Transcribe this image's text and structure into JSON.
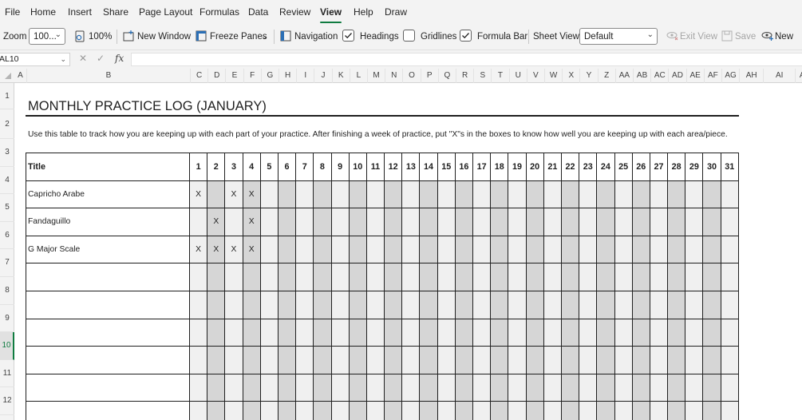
{
  "menu": {
    "tabs": [
      "File",
      "Home",
      "Insert",
      "Share",
      "Page Layout",
      "Formulas",
      "Data",
      "Review",
      "View",
      "Help",
      "Draw"
    ],
    "active": "View"
  },
  "ribbon": {
    "zoom_label": "Zoom",
    "zoom_value": "100...",
    "zoom_100_label": "100%",
    "new_window_label": "New Window",
    "freeze_panes_label": "Freeze Panes",
    "navigation_label": "Navigation",
    "headings_label": "Headings",
    "headings_checked": true,
    "gridlines_label": "Gridlines",
    "gridlines_checked": false,
    "formula_bar_label": "Formula Bar",
    "formula_bar_checked": true,
    "sheet_view_label": "Sheet View",
    "sheet_view_value": "Default",
    "exit_view_label": "Exit View",
    "save_label": "Save",
    "new_label": "New"
  },
  "formula_bar": {
    "name_box": "AL10",
    "fx_label": "fx",
    "formula": ""
  },
  "grid": {
    "columns": [
      "A",
      "B",
      "C",
      "D",
      "E",
      "F",
      "G",
      "H",
      "I",
      "J",
      "K",
      "L",
      "M",
      "N",
      "O",
      "P",
      "Q",
      "R",
      "S",
      "T",
      "U",
      "V",
      "W",
      "X",
      "Y",
      "Z",
      "AA",
      "AB",
      "AC",
      "AD",
      "AE",
      "AF",
      "AG",
      "AH",
      "AI",
      "AJ"
    ],
    "rows": [
      "1",
      "2",
      "3",
      "4",
      "5",
      "6",
      "7",
      "8",
      "9",
      "10",
      "11",
      "12"
    ],
    "active_row": "10"
  },
  "sheet": {
    "title": "MONTHLY PRACTICE LOG (JANUARY)",
    "instructions": "Use this table to track how you are keeping up with each part of your practice. After finishing a week of practice, put \"X\"s in the boxes to know how well you are keeping up with each area/piece.",
    "table": {
      "header_title": "Title",
      "days": [
        "1",
        "2",
        "3",
        "4",
        "5",
        "6",
        "7",
        "8",
        "9",
        "10",
        "11",
        "12",
        "13",
        "14",
        "15",
        "16",
        "17",
        "18",
        "19",
        "20",
        "21",
        "22",
        "23",
        "24",
        "25",
        "26",
        "27",
        "28",
        "29",
        "30",
        "31"
      ],
      "rows": [
        {
          "title": "Capricho Arabe",
          "marks": [
            "X",
            "",
            "X",
            "X",
            "",
            "",
            "",
            "",
            "",
            "",
            "",
            "",
            "",
            "",
            "",
            "",
            "",
            "",
            "",
            "",
            "",
            "",
            "",
            "",
            "",
            "",
            "",
            "",
            "",
            "",
            ""
          ]
        },
        {
          "title": "Fandaguillo",
          "marks": [
            "",
            "X",
            "",
            "X",
            "",
            "",
            "",
            "",
            "",
            "",
            "",
            "",
            "",
            "",
            "",
            "",
            "",
            "",
            "",
            "",
            "",
            "",
            "",
            "",
            "",
            "",
            "",
            "",
            "",
            "",
            ""
          ]
        },
        {
          "title": "G Major Scale",
          "marks": [
            "X",
            "X",
            "X",
            "X",
            "",
            "",
            "",
            "",
            "",
            "",
            "",
            "",
            "",
            "",
            "",
            "",
            "",
            "",
            "",
            "",
            "",
            "",
            "",
            "",
            "",
            "",
            "",
            "",
            "",
            "",
            ""
          ]
        },
        {
          "title": "",
          "marks": [
            "",
            "",
            "",
            "",
            "",
            "",
            "",
            "",
            "",
            "",
            "",
            "",
            "",
            "",
            "",
            "",
            "",
            "",
            "",
            "",
            "",
            "",
            "",
            "",
            "",
            "",
            "",
            "",
            "",
            "",
            ""
          ]
        },
        {
          "title": "",
          "marks": [
            "",
            "",
            "",
            "",
            "",
            "",
            "",
            "",
            "",
            "",
            "",
            "",
            "",
            "",
            "",
            "",
            "",
            "",
            "",
            "",
            "",
            "",
            "",
            "",
            "",
            "",
            "",
            "",
            "",
            "",
            ""
          ]
        },
        {
          "title": "",
          "marks": [
            "",
            "",
            "",
            "",
            "",
            "",
            "",
            "",
            "",
            "",
            "",
            "",
            "",
            "",
            "",
            "",
            "",
            "",
            "",
            "",
            "",
            "",
            "",
            "",
            "",
            "",
            "",
            "",
            "",
            "",
            ""
          ]
        },
        {
          "title": "",
          "marks": [
            "",
            "",
            "",
            "",
            "",
            "",
            "",
            "",
            "",
            "",
            "",
            "",
            "",
            "",
            "",
            "",
            "",
            "",
            "",
            "",
            "",
            "",
            "",
            "",
            "",
            "",
            "",
            "",
            "",
            "",
            ""
          ]
        },
        {
          "title": "",
          "marks": [
            "",
            "",
            "",
            "",
            "",
            "",
            "",
            "",
            "",
            "",
            "",
            "",
            "",
            "",
            "",
            "",
            "",
            "",
            "",
            "",
            "",
            "",
            "",
            "",
            "",
            "",
            "",
            "",
            "",
            "",
            ""
          ]
        },
        {
          "title": "",
          "marks": [
            "",
            "",
            "",
            "",
            "",
            "",
            "",
            "",
            "",
            "",
            "",
            "",
            "",
            "",
            "",
            "",
            "",
            "",
            "",
            "",
            "",
            "",
            "",
            "",
            "",
            "",
            "",
            "",
            "",
            "",
            ""
          ]
        }
      ]
    }
  },
  "colors": {
    "accent": "#107c41",
    "shade_dark": "#d6d6d6",
    "shade_light": "#f0f0f0"
  }
}
